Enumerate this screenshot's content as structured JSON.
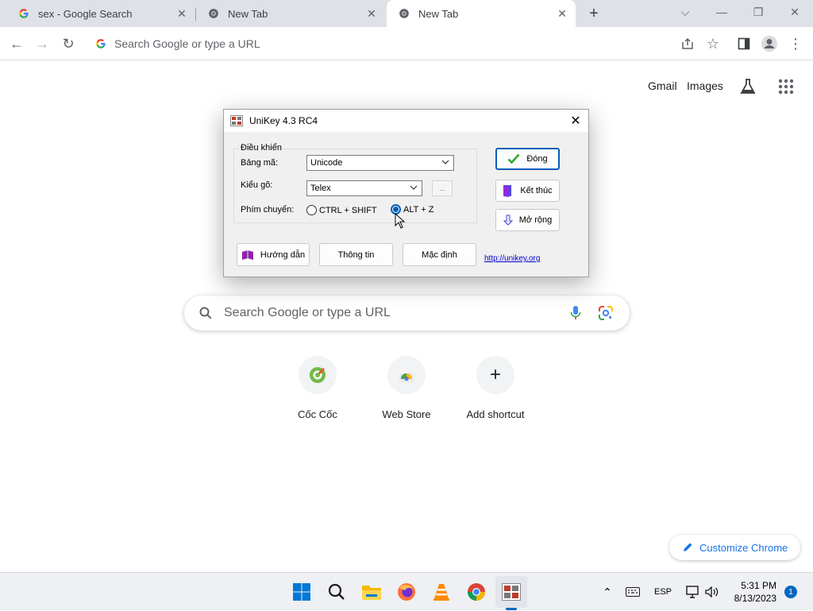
{
  "browser": {
    "tabs": [
      {
        "title": "sex - Google Search",
        "favicon": "google-g-icon",
        "active": false
      },
      {
        "title": "New Tab",
        "favicon": "chrome-icon",
        "active": false
      },
      {
        "title": "New Tab",
        "favicon": "chrome-icon",
        "active": true
      }
    ],
    "omnibox_placeholder": "Search Google or type a URL"
  },
  "ntp": {
    "links": {
      "gmail": "Gmail",
      "images": "Images"
    },
    "search_placeholder": "Search Google or type a URL",
    "shortcuts": [
      {
        "label": "Cốc Cốc",
        "icon": "coccoc-icon"
      },
      {
        "label": "Web Store",
        "icon": "web-store-icon"
      },
      {
        "label": "Add shortcut",
        "icon": "plus-icon"
      }
    ],
    "customize_label": "Customize Chrome"
  },
  "dialog": {
    "title": "UniKey 4.3 RC4",
    "group_label": "Điều khiển",
    "charset_label": "Bảng mã:",
    "charset_value": "Unicode",
    "input_label": "Kiểu gõ:",
    "input_value": "Telex",
    "more_button": "...",
    "switch_label": "Phím chuyển:",
    "switch_options": [
      {
        "label": "CTRL + SHIFT",
        "selected": false
      },
      {
        "label": "ALT + Z",
        "selected": true
      }
    ],
    "close_button": "Đóng",
    "exit_button": "Kết thúc",
    "expand_button": "Mở rộng",
    "help_button": "Hướng dẫn",
    "info_button": "Thông tin",
    "default_button": "Mặc định",
    "link": "http://unikey.org"
  },
  "taskbar": {
    "apps": [
      "windows-start-icon",
      "search-icon",
      "file-explorer-icon",
      "firefox-icon",
      "vlc-icon",
      "chrome-icon",
      "unikey-icon"
    ],
    "language": "ESP",
    "time": "5:31 PM",
    "date": "8/13/2023",
    "notification_count": "1"
  },
  "colors": {
    "accent": "#1a73e8",
    "dialog_focus": "#005fb8",
    "link": "#0000cc"
  }
}
